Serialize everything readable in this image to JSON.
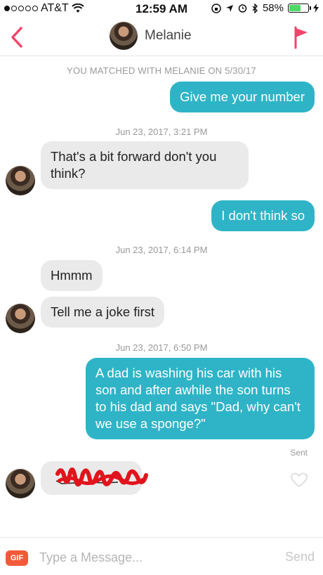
{
  "status_bar": {
    "carrier": "AT&T",
    "time": "12:59 AM",
    "battery": "58%",
    "battery_level": 0.58,
    "signal_dots_filled": 1,
    "signal_dots_total": 5
  },
  "header": {
    "contact_name": "Melanie",
    "back_icon": "chevron-left-icon",
    "report_icon": "flag-icon",
    "accent_color": "#f2446b"
  },
  "conversation": {
    "match_note": "YOU MATCHED WITH MELANIE ON 5/30/17",
    "timestamps": [
      "Jun 23, 2017, 3:21 PM",
      "Jun 23, 2017, 6:14 PM",
      "Jun 23, 2017, 6:50 PM"
    ],
    "messages": [
      {
        "from": "me",
        "text": "Give me your number"
      },
      {
        "from": "them",
        "text": "That's a bit forward don't you think?"
      },
      {
        "from": "me",
        "text": "I don't think so"
      },
      {
        "from": "them",
        "text": "Hmmm"
      },
      {
        "from": "them",
        "text": "Tell me a joke first"
      },
      {
        "from": "me",
        "text": "A dad is washing his car with his son and after awhile the son turns to his dad and says \"Dad, why can't we use a sponge?\""
      },
      {
        "from": "them",
        "text": ""
      }
    ],
    "sent_label": "Sent",
    "outgoing_color": "#2fb4c7",
    "incoming_color": "#eaeaea"
  },
  "composer": {
    "gif_label": "GIF",
    "placeholder": "Type a Message...",
    "send_label": "Send"
  }
}
